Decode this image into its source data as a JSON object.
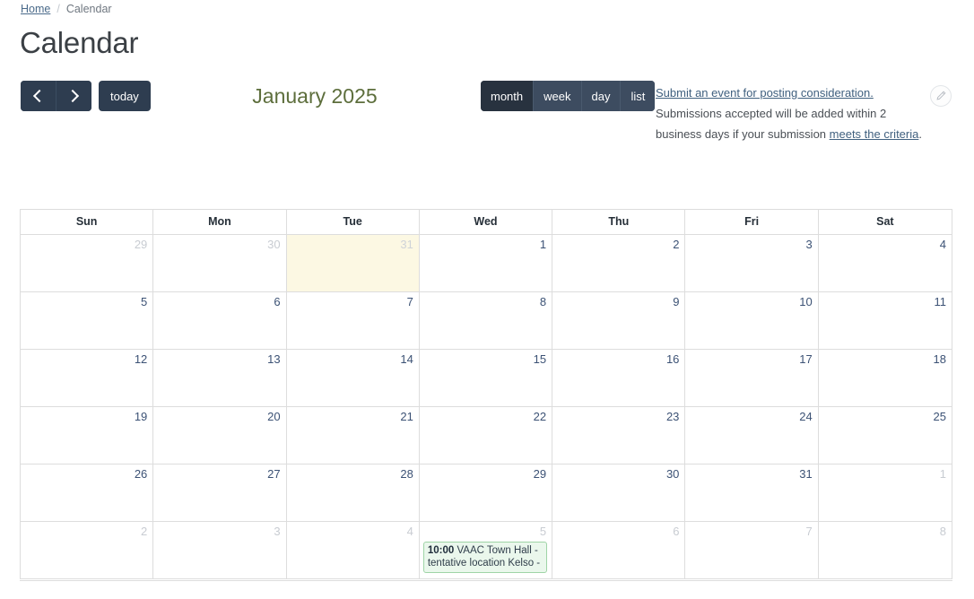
{
  "breadcrumb": {
    "home_label": "Home",
    "separator": "/",
    "current_label": "Calendar"
  },
  "page_title": "Calendar",
  "toolbar": {
    "prev_label": "prev-chevron-icon",
    "next_label": "next-chevron-icon",
    "today_label": "today",
    "calendar_title": "January 2025",
    "views": [
      {
        "label": "month",
        "active": true
      },
      {
        "label": "week",
        "active": false
      },
      {
        "label": "day",
        "active": false
      },
      {
        "label": "list",
        "active": false
      }
    ],
    "edit_icon": "pencil-icon"
  },
  "submit_note": {
    "link1": "Submit an event for posting consideration.",
    "line2": "Submissions accepted will be added within 2",
    "line3_prefix": "business days if your submission ",
    "link2": "meets the criteria",
    "line3_suffix": "."
  },
  "calendar": {
    "day_headers": [
      "Sun",
      "Mon",
      "Tue",
      "Wed",
      "Thu",
      "Fri",
      "Sat"
    ],
    "weeks": [
      {
        "days": [
          {
            "num": "29",
            "other": true,
            "today": false,
            "events": []
          },
          {
            "num": "30",
            "other": true,
            "today": false,
            "events": []
          },
          {
            "num": "31",
            "other": true,
            "today": true,
            "events": []
          },
          {
            "num": "1",
            "other": false,
            "today": false,
            "events": []
          },
          {
            "num": "2",
            "other": false,
            "today": false,
            "events": []
          },
          {
            "num": "3",
            "other": false,
            "today": false,
            "events": []
          },
          {
            "num": "4",
            "other": false,
            "today": false,
            "events": []
          }
        ]
      },
      {
        "days": [
          {
            "num": "5",
            "other": false,
            "today": false,
            "events": []
          },
          {
            "num": "6",
            "other": false,
            "today": false,
            "events": []
          },
          {
            "num": "7",
            "other": false,
            "today": false,
            "events": []
          },
          {
            "num": "8",
            "other": false,
            "today": false,
            "events": []
          },
          {
            "num": "9",
            "other": false,
            "today": false,
            "events": []
          },
          {
            "num": "10",
            "other": false,
            "today": false,
            "events": []
          },
          {
            "num": "11",
            "other": false,
            "today": false,
            "events": []
          }
        ]
      },
      {
        "days": [
          {
            "num": "12",
            "other": false,
            "today": false,
            "events": []
          },
          {
            "num": "13",
            "other": false,
            "today": false,
            "events": []
          },
          {
            "num": "14",
            "other": false,
            "today": false,
            "events": []
          },
          {
            "num": "15",
            "other": false,
            "today": false,
            "events": []
          },
          {
            "num": "16",
            "other": false,
            "today": false,
            "events": []
          },
          {
            "num": "17",
            "other": false,
            "today": false,
            "events": []
          },
          {
            "num": "18",
            "other": false,
            "today": false,
            "events": []
          }
        ]
      },
      {
        "days": [
          {
            "num": "19",
            "other": false,
            "today": false,
            "events": []
          },
          {
            "num": "20",
            "other": false,
            "today": false,
            "events": []
          },
          {
            "num": "21",
            "other": false,
            "today": false,
            "events": []
          },
          {
            "num": "22",
            "other": false,
            "today": false,
            "events": []
          },
          {
            "num": "23",
            "other": false,
            "today": false,
            "events": []
          },
          {
            "num": "24",
            "other": false,
            "today": false,
            "events": []
          },
          {
            "num": "25",
            "other": false,
            "today": false,
            "events": []
          }
        ]
      },
      {
        "days": [
          {
            "num": "26",
            "other": false,
            "today": false,
            "events": []
          },
          {
            "num": "27",
            "other": false,
            "today": false,
            "events": []
          },
          {
            "num": "28",
            "other": false,
            "today": false,
            "events": []
          },
          {
            "num": "29",
            "other": false,
            "today": false,
            "events": []
          },
          {
            "num": "30",
            "other": false,
            "today": false,
            "events": []
          },
          {
            "num": "31",
            "other": false,
            "today": false,
            "events": []
          },
          {
            "num": "1",
            "other": true,
            "today": false,
            "events": []
          }
        ]
      },
      {
        "days": [
          {
            "num": "2",
            "other": true,
            "today": false,
            "events": []
          },
          {
            "num": "3",
            "other": true,
            "today": false,
            "events": []
          },
          {
            "num": "4",
            "other": true,
            "today": false,
            "events": []
          },
          {
            "num": "5",
            "other": true,
            "today": false,
            "events": [
              {
                "time": "10:00",
                "title": "VAAC Town Hall - tentative location Kelso -"
              }
            ]
          },
          {
            "num": "6",
            "other": true,
            "today": false,
            "events": []
          },
          {
            "num": "7",
            "other": true,
            "today": false,
            "events": []
          },
          {
            "num": "8",
            "other": true,
            "today": false,
            "events": []
          }
        ]
      }
    ]
  },
  "colors": {
    "button_dark": "#2e3d50",
    "view_inactive": "#3d4c60",
    "view_active": "#28323f",
    "title_green": "#5d6e3c",
    "today_bg": "#fcf8e3",
    "event_bg": "#eaf7ec",
    "event_border": "#9fd4a6",
    "grid_border": "#dddddd",
    "daynum": "#3c5275",
    "link": "#40607f"
  }
}
